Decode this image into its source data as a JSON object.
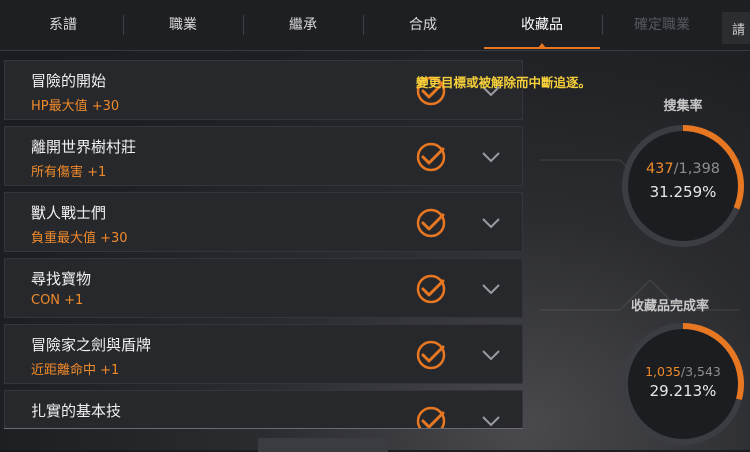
{
  "tabs": [
    {
      "label": "系譜",
      "state": "normal"
    },
    {
      "label": "職業",
      "state": "normal"
    },
    {
      "label": "繼承",
      "state": "normal"
    },
    {
      "label": "合成",
      "state": "normal"
    },
    {
      "label": "收藏品",
      "state": "active"
    },
    {
      "label": "確定職業",
      "state": "disabled"
    }
  ],
  "tab_partial_label": "請",
  "notice": "變更目標或被解除而中斷追逐。",
  "collection": [
    {
      "title": "冒險的開始",
      "bonus": "HP最大值  +30",
      "completed": true
    },
    {
      "title": "離開世界樹村莊",
      "bonus": "所有傷害  +1",
      "completed": true
    },
    {
      "title": "獸人戰士們",
      "bonus": "負重最大值  +30",
      "completed": true
    },
    {
      "title": "尋找寶物",
      "bonus": "CON  +1",
      "completed": true
    },
    {
      "title": "冒險家之劍與盾牌",
      "bonus": "近距離命中  +1",
      "completed": true
    },
    {
      "title": "扎實的基本技",
      "bonus": "",
      "completed": true
    }
  ],
  "stats": {
    "search_rate": {
      "label": "搜集率",
      "current": "437",
      "total": "/1,398",
      "percent": "31.259%",
      "fraction": 0.31259
    },
    "completion_rate": {
      "label": "收藏品完成率",
      "current": "1,035",
      "total": "/3,543",
      "percent": "29.213%",
      "fraction": 0.29213
    }
  },
  "colors": {
    "accent": "#e87722",
    "bonus": "#f08a2b",
    "notice": "#f6cf3a",
    "row_bg": "#26282c"
  }
}
